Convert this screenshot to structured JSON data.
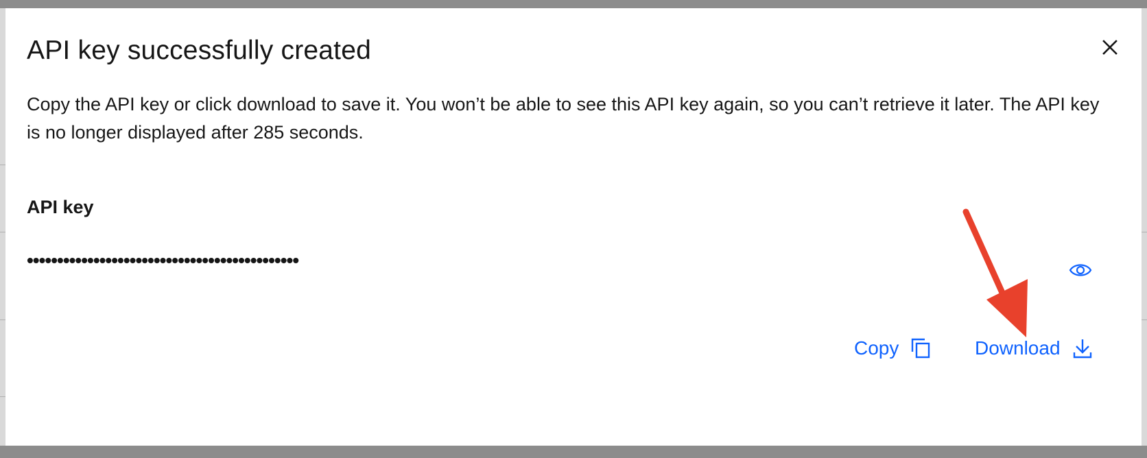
{
  "modal": {
    "title": "API key successfully created",
    "description": "Copy the API key or click download to save it. You won’t be able to see this API key again, so you can’t retrieve it later. The API key is no longer displayed after 285 seconds.",
    "field_label": "API key",
    "masked_key": "•••••••••••••••••••••••••••••••••••••••••••••",
    "copy_label": "Copy",
    "download_label": "Download"
  },
  "icons": {
    "close": "close-icon",
    "show": "eye-icon",
    "copy": "copy-icon",
    "download": "download-icon"
  },
  "colors": {
    "link": "#0f62fe",
    "annotation": "#e8412c",
    "backdrop": "#8c8c8c"
  }
}
